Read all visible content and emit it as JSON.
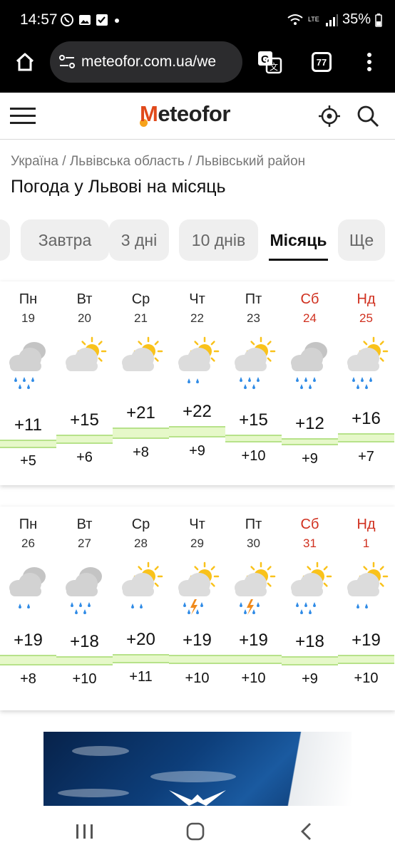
{
  "status_bar": {
    "time": "14:57",
    "battery": "35%",
    "network": "LTE"
  },
  "browser": {
    "url": "meteofor.com.ua/we",
    "tab_count": "77"
  },
  "site": {
    "logo": "Meteofor",
    "logo_initial": "M",
    "logo_rest": "eteofor"
  },
  "breadcrumb": "Україна / Львівська область / Львівський район",
  "page_title": "Погода у Львові на місяць",
  "tabs": [
    {
      "label": "Завтра",
      "active": false
    },
    {
      "label": "3 дні",
      "active": false
    },
    {
      "label": "10 днів",
      "active": false
    },
    {
      "label": "Місяць",
      "active": true
    },
    {
      "label": "Ще",
      "active": false
    }
  ],
  "weeks": [
    {
      "days": [
        {
          "name": "Пн",
          "date": "19",
          "weekend": false,
          "icon": "cloud-rain-icon",
          "max": "+11",
          "min": "+5",
          "max_val": 11,
          "min_val": 5
        },
        {
          "name": "Вт",
          "date": "20",
          "weekend": false,
          "icon": "partly-cloudy-icon",
          "max": "+15",
          "min": "+6",
          "max_val": 15,
          "min_val": 6
        },
        {
          "name": "Ср",
          "date": "21",
          "weekend": false,
          "icon": "sun-behind-cloud-icon",
          "max": "+21",
          "min": "+8",
          "max_val": 21,
          "min_val": 8
        },
        {
          "name": "Чт",
          "date": "22",
          "weekend": false,
          "icon": "sun-cloud-light-rain-icon",
          "max": "+22",
          "min": "+9",
          "max_val": 22,
          "min_val": 9
        },
        {
          "name": "Пт",
          "date": "23",
          "weekend": false,
          "icon": "sun-cloud-rain-icon",
          "max": "+15",
          "min": "+10",
          "max_val": 15,
          "min_val": 10
        },
        {
          "name": "Сб",
          "date": "24",
          "weekend": true,
          "icon": "cloud-rain-icon",
          "max": "+12",
          "min": "+9",
          "max_val": 12,
          "min_val": 9
        },
        {
          "name": "Нд",
          "date": "25",
          "weekend": true,
          "icon": "sun-cloud-rain-icon",
          "max": "+16",
          "min": "+7",
          "max_val": 16,
          "min_val": 7
        }
      ]
    },
    {
      "days": [
        {
          "name": "Пн",
          "date": "26",
          "weekend": false,
          "icon": "cloud-light-rain-icon",
          "max": "+19",
          "min": "+8",
          "max_val": 19,
          "min_val": 8
        },
        {
          "name": "Вт",
          "date": "27",
          "weekend": false,
          "icon": "cloud-rain-icon",
          "max": "+18",
          "min": "+10",
          "max_val": 18,
          "min_val": 10
        },
        {
          "name": "Ср",
          "date": "28",
          "weekend": false,
          "icon": "sun-cloud-light-rain-icon",
          "max": "+20",
          "min": "+11",
          "max_val": 20,
          "min_val": 11
        },
        {
          "name": "Чт",
          "date": "29",
          "weekend": false,
          "icon": "sun-cloud-thunderstorm-icon",
          "max": "+19",
          "min": "+10",
          "max_val": 19,
          "min_val": 10
        },
        {
          "name": "Пт",
          "date": "30",
          "weekend": false,
          "icon": "sun-cloud-thunderstorm-icon",
          "max": "+19",
          "min": "+10",
          "max_val": 19,
          "min_val": 10
        },
        {
          "name": "Сб",
          "date": "31",
          "weekend": true,
          "icon": "sun-cloud-rain-icon",
          "max": "+18",
          "min": "+9",
          "max_val": 18,
          "min_val": 9
        },
        {
          "name": "Нд",
          "date": "1",
          "weekend": true,
          "icon": "sun-cloud-light-rain-icon",
          "max": "+19",
          "min": "+10",
          "max_val": 19,
          "min_val": 10
        }
      ]
    }
  ],
  "colors": {
    "brand_orange": "#e0491b",
    "brand_yellow": "#f7a21b",
    "weekend_red": "#d0301f",
    "band_fill": "#e6f8c9",
    "band_line": "#b7e28a",
    "rain_blue": "#2f8be6",
    "sun_yellow": "#f9c21b"
  }
}
